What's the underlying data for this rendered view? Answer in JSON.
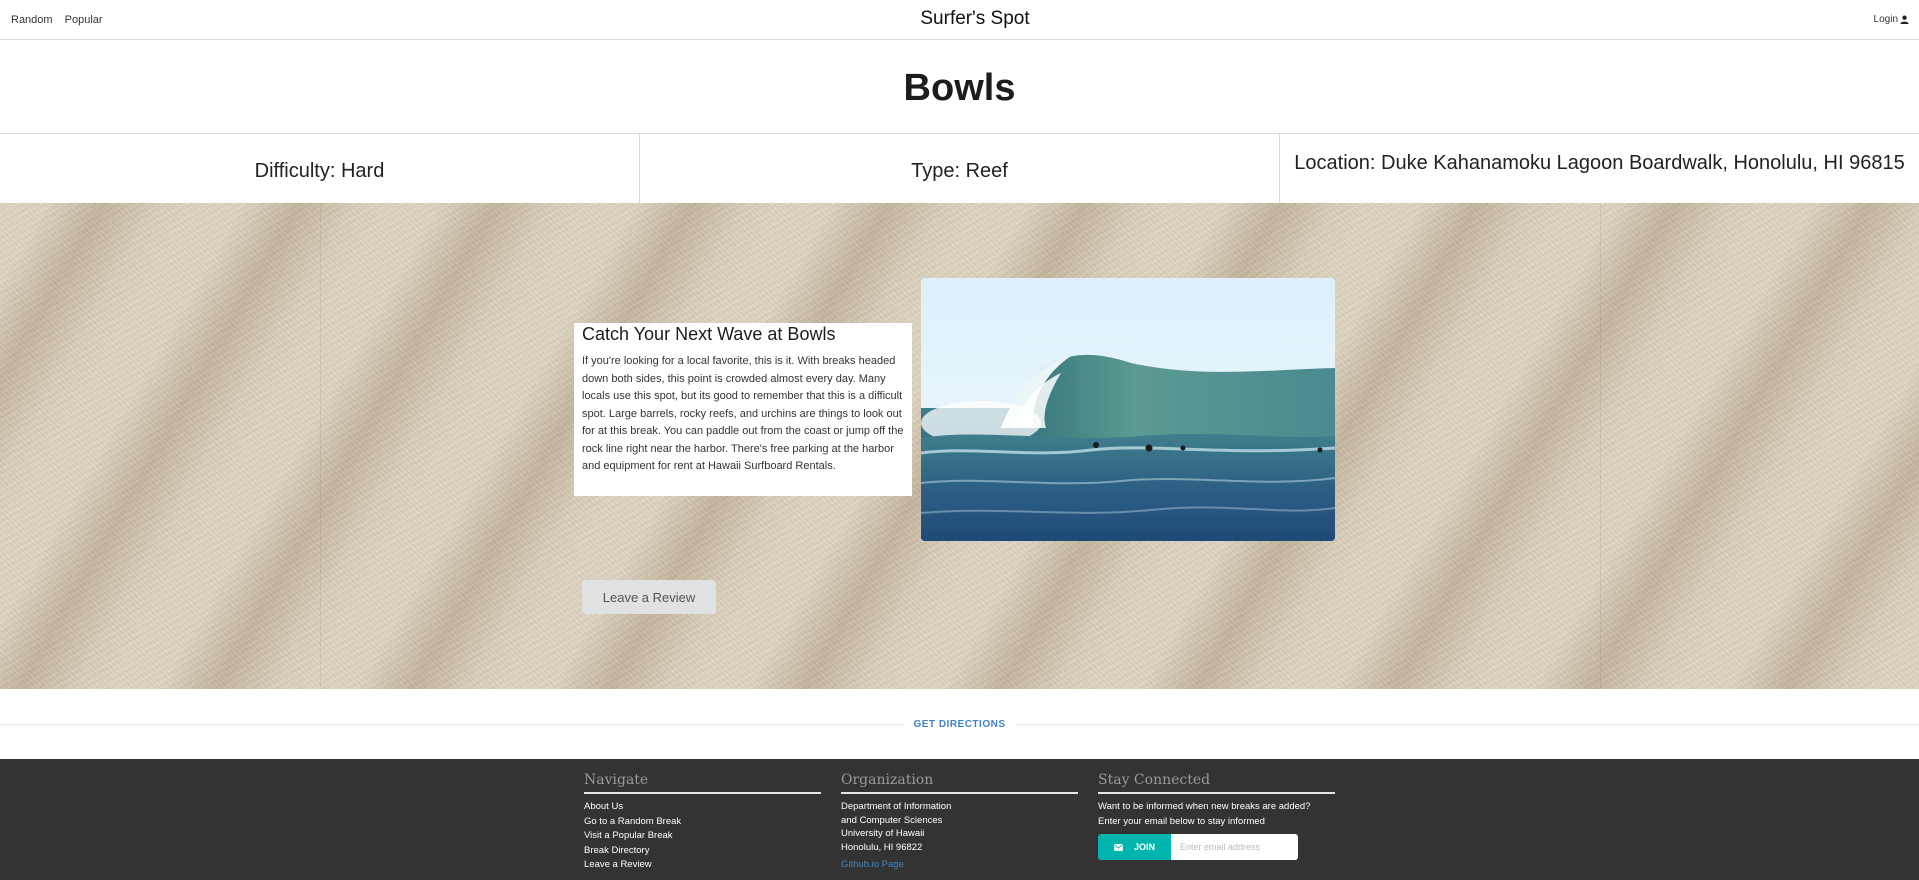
{
  "nav": {
    "random": "Random",
    "popular": "Popular",
    "brand": "Surfer's Spot",
    "login": "Login",
    "login_icon": "user-icon"
  },
  "spot": {
    "name": "Bowls",
    "difficulty": "Difficulty: Hard",
    "type": "Type: Reef",
    "location": "Location: Duke Kahanamoku Lagoon Boardwalk, Honolulu, HI 96815"
  },
  "description": {
    "heading": "Catch Your Next Wave at Bowls",
    "body": "If you're looking for a local favorite, this is it. With breaks headed down both sides, this point is crowded almost every day. Many locals use this spot, but its good to remember that this is a difficult spot. Large barrels, rocky reefs, and urchins are things to look out for at this break. You can paddle out from the coast or jump off the rock line right near the harbor. There's free parking at the harbor and equipment for rent at Hawaii Surfboard Rentals."
  },
  "review_button": "Leave a Review",
  "directions_label": "GET DIRECTIONS",
  "footer": {
    "navigate": {
      "heading": "Navigate",
      "links": [
        "About Us",
        "Go to a Random Break",
        "Visit a Popular Break",
        "Break Directory",
        "Leave a Review"
      ]
    },
    "organization": {
      "heading": "Organization",
      "lines": [
        "Department of Information",
        "and Computer Sciences",
        "University of Hawaii",
        "Honolulu, HI 96822"
      ],
      "link": "Github.io Page"
    },
    "stay": {
      "heading": "Stay Connected",
      "line1": "Want to be informed when new breaks are added?",
      "line2": "Enter your email below to stay informed",
      "join_label": "JOIN",
      "join_icon": "mail-icon",
      "email_placeholder": "Enter email address"
    }
  },
  "colors": {
    "footer_bg": "#333333",
    "accent_teal": "#00b5ad",
    "link_blue": "#4183c4"
  }
}
